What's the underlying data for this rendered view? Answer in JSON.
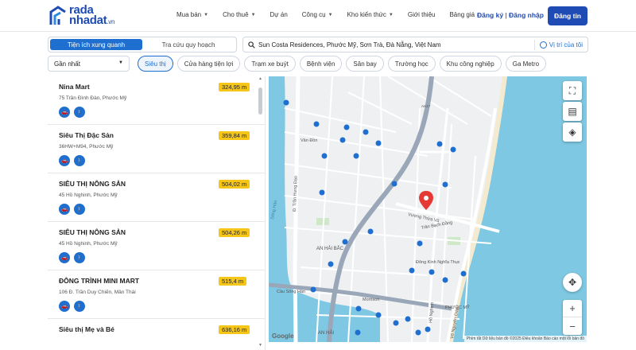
{
  "brand": {
    "line1": "rada",
    "line2": "nhadat",
    "suffix": ".vn",
    "color": "#1f4bb5"
  },
  "nav": [
    {
      "label": "Mua bán",
      "dropdown": true
    },
    {
      "label": "Cho thuê",
      "dropdown": true
    },
    {
      "label": "Dự án",
      "dropdown": false
    },
    {
      "label": "Công cụ",
      "dropdown": true
    },
    {
      "label": "Kho kiến thức",
      "dropdown": true
    },
    {
      "label": "Giới thiệu",
      "dropdown": false
    },
    {
      "label": "Bảng giá",
      "dropdown": false
    }
  ],
  "auth": {
    "register": "Đăng ký",
    "sep": " | ",
    "login": "Đăng nhập"
  },
  "post_button": "Đăng tin",
  "tabs": {
    "active": "Tiện ích xung quanh",
    "other": "Tra cứu quy hoạch"
  },
  "search": {
    "value": "Sun Costa Residences, Phước Mỹ, Sơn Trà, Đà Nẵng, Việt Nam",
    "locate": "Vị trí của tôi"
  },
  "sort": {
    "value": "Gần nhất"
  },
  "chips": [
    "Siêu thị",
    "Cửa hàng tiện lợi",
    "Trạm xe buýt",
    "Bệnh viện",
    "Sân bay",
    "Trường học",
    "Khu công nghiệp",
    "Ga Metro"
  ],
  "places": [
    {
      "name": "Nina Mart",
      "address": "75 Trần Đình Đàn, Phước Mỹ",
      "distance": "324,95 m"
    },
    {
      "name": "Siêu Thị Đặc Sản",
      "address": "36HW+M94, Phước Mỹ",
      "distance": "359,84 m"
    },
    {
      "name": "SIÊU THỊ NÔNG SẢN",
      "address": "45 Hồ Nghinh, Phước Mỹ",
      "distance": "504,02 m"
    },
    {
      "name": "SIÊU THỊ NÔNG SẢN",
      "address": "45 Hồ Nghinh, Phước Mỹ",
      "distance": "504,26 m"
    },
    {
      "name": "ĐÔNG TRÌNH MINI MART",
      "address": "106 Đ. Trần Duy Chiến, Mân Thái",
      "distance": "515,4 m"
    },
    {
      "name": "Siêu thị Mẹ và Bé",
      "address": "",
      "distance": "636,16 m"
    }
  ],
  "map": {
    "labels": {
      "an_hai_bac": "AN HẢI BẮC",
      "an_hai": "AN HẢI",
      "phuoc_my": "PHƯỚC MỸ",
      "song_han": "Sông Hàn",
      "cau_song_han": "Cầu Sông Hàn",
      "morrison": "Morrison",
      "vuong_thua_vu": "Vương Thừa Vũ",
      "tran_bach_dang": "Trần Bạch Đằng",
      "ho_nghinh": "Hồ Nghinh",
      "vo_nguyen_giap": "Võ Nguyên Giáp",
      "dong_kinh_nghia_thuc": "Đông Kinh Nghĩa Thục",
      "tran_hung_dao": "Đ. Trần Hưng Đạo",
      "van_don": "Vân Đồn",
      "ah17": "AH17"
    },
    "attribution": "Phím tắt   Dữ liệu bản đồ ©2025   Điều khoản   Báo cáo một lỗi bản đồ",
    "google": "Google",
    "water_color": "#7ec8e3",
    "pin_color": "#e53935",
    "marker_color": "#1f6fd1"
  },
  "icons": [
    "logo-mark",
    "search-icon",
    "target-icon",
    "chevron-down-icon",
    "car-icon",
    "walk-icon",
    "fullscreen-icon",
    "list-icon",
    "layers-icon",
    "pan-icon",
    "zoom-in-icon",
    "zoom-out-icon",
    "location-pin-icon",
    "shop-marker-icon"
  ]
}
